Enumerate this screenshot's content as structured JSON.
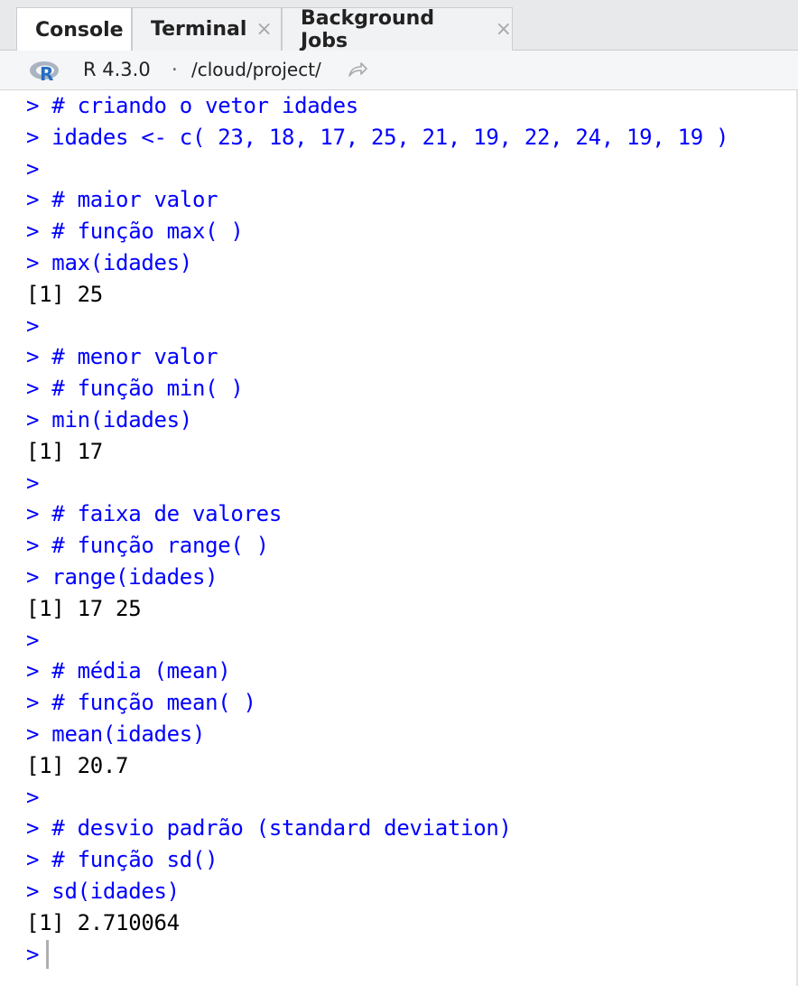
{
  "tabs": [
    {
      "label": "Console",
      "active": true,
      "closable": false
    },
    {
      "label": "Terminal",
      "active": false,
      "closable": true
    },
    {
      "label": "Background Jobs",
      "active": false,
      "closable": true
    }
  ],
  "toolbar": {
    "r_version": "R 4.3.0",
    "separator": "·",
    "working_dir": "/cloud/project/",
    "logo_icon": "r-logo-icon",
    "link_icon": "go-to-directory-icon"
  },
  "console": {
    "lines": [
      {
        "type": "input",
        "text": "> # criando o vetor idades"
      },
      {
        "type": "input",
        "text": "> idades <- c( 23, 18, 17, 25, 21, 19, 22, 24, 19, 19 )"
      },
      {
        "type": "input",
        "text": ">"
      },
      {
        "type": "input",
        "text": "> # maior valor"
      },
      {
        "type": "input",
        "text": "> # função max( )"
      },
      {
        "type": "input",
        "text": "> max(idades)"
      },
      {
        "type": "output",
        "text": "[1] 25"
      },
      {
        "type": "input",
        "text": ">"
      },
      {
        "type": "input",
        "text": "> # menor valor"
      },
      {
        "type": "input",
        "text": "> # função min( )"
      },
      {
        "type": "input",
        "text": "> min(idades)"
      },
      {
        "type": "output",
        "text": "[1] 17"
      },
      {
        "type": "input",
        "text": ">"
      },
      {
        "type": "input",
        "text": "> # faixa de valores"
      },
      {
        "type": "input",
        "text": "> # função range( )"
      },
      {
        "type": "input",
        "text": "> range(idades)"
      },
      {
        "type": "output",
        "text": "[1] 17 25"
      },
      {
        "type": "input",
        "text": ">"
      },
      {
        "type": "input",
        "text": "> # média (mean)"
      },
      {
        "type": "input",
        "text": "> # função mean( )"
      },
      {
        "type": "input",
        "text": "> mean(idades)"
      },
      {
        "type": "output",
        "text": "[1] 20.7"
      },
      {
        "type": "input",
        "text": ">"
      },
      {
        "type": "input",
        "text": "> # desvio padrão (standard deviation)"
      },
      {
        "type": "input",
        "text": "> # função sd()"
      },
      {
        "type": "input",
        "text": "> sd(idades)"
      },
      {
        "type": "output",
        "text": "[1] 2.710064"
      }
    ],
    "prompt": ">"
  },
  "colors": {
    "input_text": "#0000ff",
    "output_text": "#000000",
    "tabbar_bg": "#e8e9eb"
  }
}
